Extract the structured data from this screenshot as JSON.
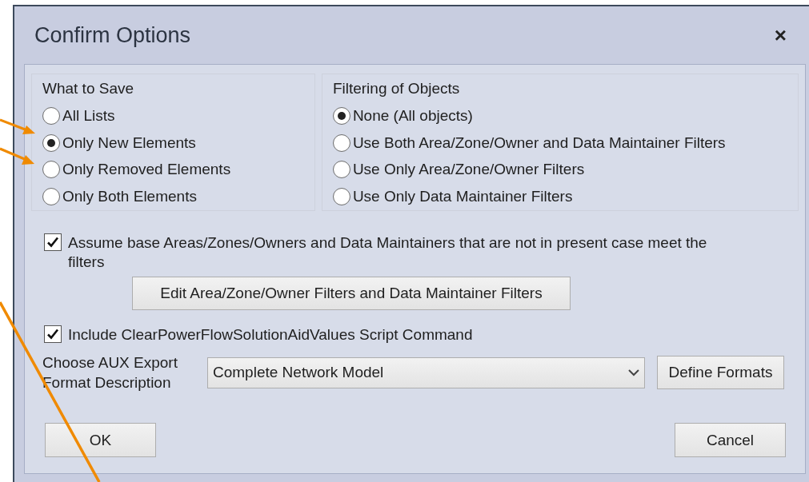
{
  "window": {
    "title": "Confirm Options",
    "close": "×"
  },
  "what_to_save": {
    "label": "What to Save",
    "options": [
      {
        "label": "All Lists",
        "selected": false
      },
      {
        "label": "Only New Elements",
        "selected": true
      },
      {
        "label": "Only Removed Elements",
        "selected": false
      },
      {
        "label": "Only Both Elements",
        "selected": false
      }
    ]
  },
  "filtering": {
    "label": "Filtering of Objects",
    "options": [
      {
        "label": "None (All objects)",
        "selected": true
      },
      {
        "label": "Use Both Area/Zone/Owner and Data Maintainer Filters",
        "selected": false
      },
      {
        "label": "Use Only Area/Zone/Owner Filters",
        "selected": false
      },
      {
        "label": "Use Only Data Maintainer Filters",
        "selected": false
      }
    ]
  },
  "assume_checkbox": {
    "label": "Assume base Areas/Zones/Owners and Data Maintainers that are not in present case meet the filters",
    "checked": true
  },
  "edit_filters_button": "Edit Area/Zone/Owner Filters and Data Maintainer Filters",
  "include_checkbox": {
    "label": "Include ClearPowerFlowSolutionAidValues Script Command",
    "checked": true
  },
  "export": {
    "label": "Choose AUX Export Format Description",
    "value": "Complete Network Model",
    "define_button": "Define Formats"
  },
  "buttons": {
    "ok": "OK",
    "cancel": "Cancel"
  }
}
